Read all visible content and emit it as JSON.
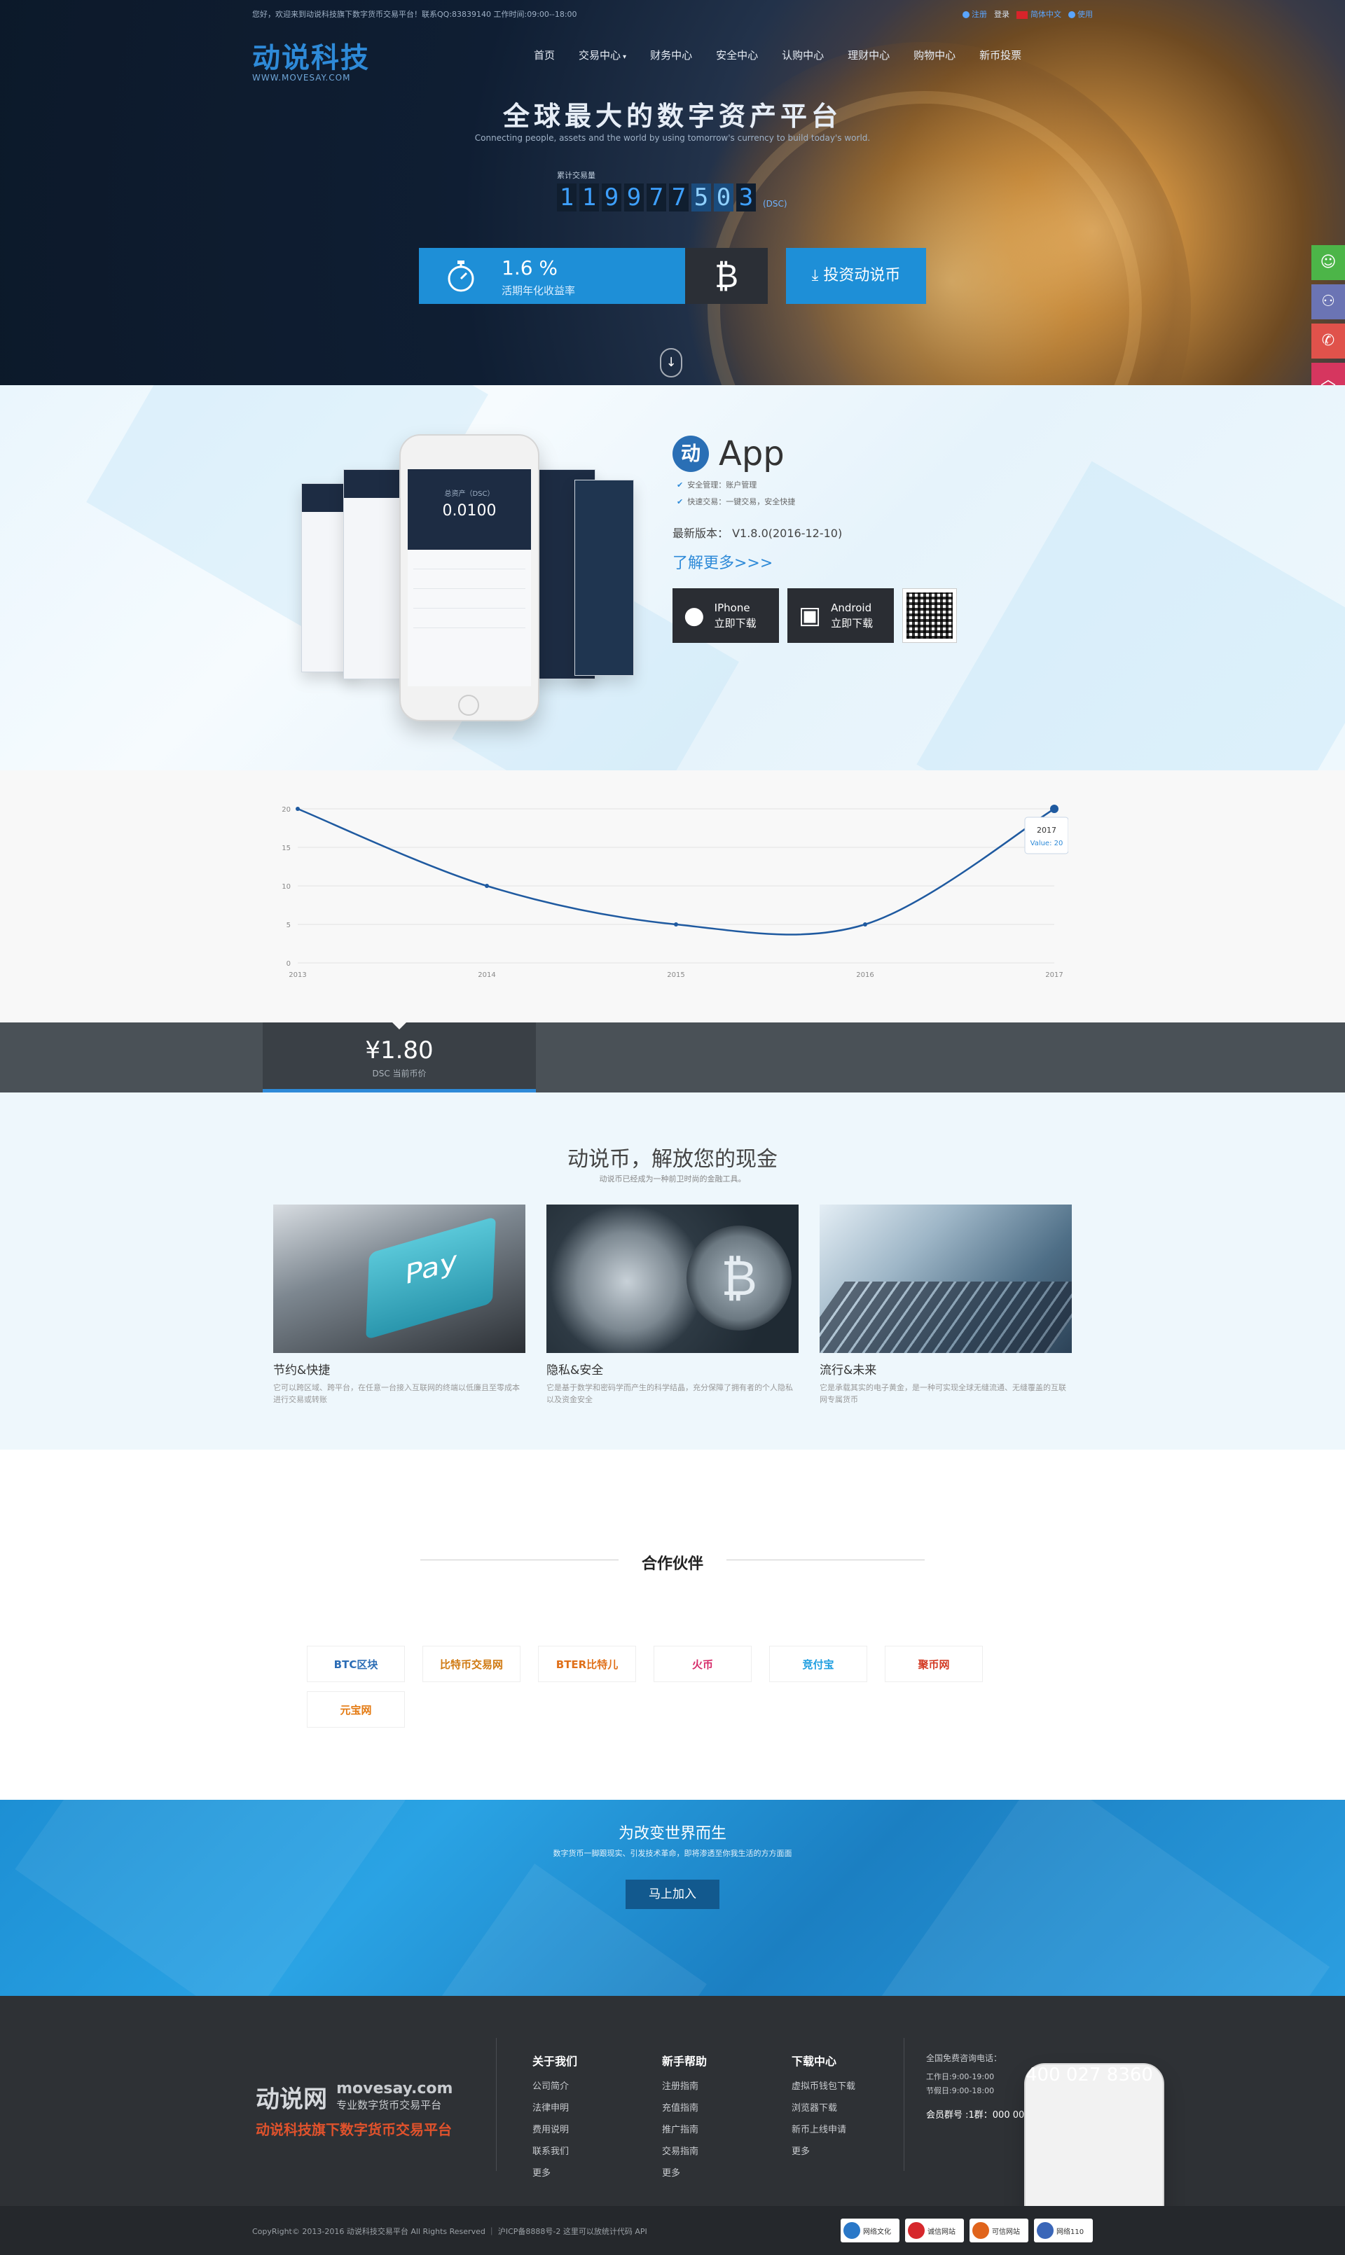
{
  "topbar": {
    "welcome": "您好，欢迎来到动说科技旗下数字货币交易平台！联系QQ:83839140 工作时间:09:00--18:00",
    "register": "注册",
    "login": "登录",
    "language": "简体中文",
    "lang_alt": "使用"
  },
  "logo": {
    "name": "动说科技",
    "domain": "WWW.MOVESAY.COM"
  },
  "nav": [
    {
      "label": "首页"
    },
    {
      "label": "交易中心",
      "chevron": "chevron-down-icon"
    },
    {
      "label": "财务中心"
    },
    {
      "label": "安全中心"
    },
    {
      "label": "认购中心"
    },
    {
      "label": "理财中心"
    },
    {
      "label": "购物中心"
    },
    {
      "label": "新币投票"
    }
  ],
  "hero": {
    "title": "全球最大的数字资产平台",
    "subtitle": "Connecting people, assets and the world by using tomorrow's currency to build today's world.",
    "counter_label": "累计交易量",
    "counter_digits": [
      "1",
      "1",
      "9",
      "9",
      "7",
      "7",
      "5",
      "0",
      "3"
    ],
    "counter_unit": "(DSC)",
    "rate_value": "1.6 %",
    "rate_label": "活期年化收益率",
    "btc_symbol": "₿",
    "invest_button": "投资动说币"
  },
  "app": {
    "logo_char": "动",
    "title": "App",
    "features": [
      "安全管理：账户管理",
      "快速交易：一键交易，安全快捷"
    ],
    "version": "最新版本： V1.8.0(2016-12-10)",
    "more_link": "了解更多>>>",
    "iphone_line1": "IPhone",
    "iphone_line2": "立即下载",
    "android_line1": "Android",
    "android_line2": "立即下载",
    "phone_balance_label": "总资产（DSC）",
    "phone_balance": "0.0100"
  },
  "chart_data": {
    "type": "line",
    "x": [
      "2013",
      "2014",
      "2015",
      "2016",
      "2017"
    ],
    "values": [
      20,
      10,
      5,
      5,
      20
    ],
    "ylim": [
      0,
      20
    ],
    "yticks": [
      0,
      5,
      10,
      15,
      20
    ],
    "grid": true,
    "tooltip": {
      "title": "2017",
      "value": "Value: 20"
    },
    "color": "#1f5aa0"
  },
  "price": {
    "value": "¥1.80",
    "label": "DSC 当前币价"
  },
  "features": {
    "title": "动说币，解放您的现金",
    "subtitle": "动说币已经成为一种前卫时尚的金融工具。",
    "cards": [
      {
        "title": "节约&快捷",
        "desc": "它可以跨区域、跨平台，在任意一台接入互联网的终端以低廉且至零成本进行交易或转账",
        "img_text": "Pay"
      },
      {
        "title": "隐私&安全",
        "desc": "它是基于数学和密码学而产生的科学结晶，充分保障了拥有者的个人隐私以及资金安全",
        "img_text": "₿"
      },
      {
        "title": "流行&未来",
        "desc": "它是承载其实的电子黄金，是一种可实现全球无缝流通、无缝覆盖的互联网专属货币"
      }
    ]
  },
  "partners": {
    "title": "合作伙伴",
    "logos": [
      {
        "name": "BTC区块",
        "color": "#2b6cb5"
      },
      {
        "name": "比特币交易网",
        "color": "#d07a12"
      },
      {
        "name": "BTER比特儿",
        "color": "#e0701a"
      },
      {
        "name": "火币",
        "color": "#d62b6a"
      },
      {
        "name": "竞付宝",
        "color": "#1e9ee0"
      },
      {
        "name": "聚币网",
        "color": "#d33a24"
      },
      {
        "name": "元宝网",
        "color": "#e47a12"
      }
    ]
  },
  "cta": {
    "title": "为改变世界而生",
    "subtitle": "数字货币一脚跟现实、引发技术革命，即将渗透至你我生活的方方面面",
    "button": "马上加入"
  },
  "footer": {
    "brand": "动说网",
    "domain": "movesay.com",
    "tagline": "专业数字货币交易平台",
    "slogan": "动说科技旗下数字货币交易平台",
    "columns": [
      {
        "title": "关于我们",
        "items": [
          "公司简介",
          "法律申明",
          "费用说明",
          "联系我们",
          "更多"
        ]
      },
      {
        "title": "新手帮助",
        "items": [
          "注册指南",
          "充值指南",
          "推广指南",
          "交易指南",
          "更多"
        ]
      },
      {
        "title": "下载中心",
        "items": [
          "虚拟币钱包下载",
          "浏览器下载",
          "新币上线申请",
          "更多"
        ]
      }
    ],
    "contact_label": "全国免费咨询电话：",
    "phone": "400 027 8360",
    "hours_work": "工作日:9:00-19:00",
    "hours_holiday": "节假日:9:00-18:00",
    "group": "会员群号 :1群：000 000 0000",
    "copyright": "CopyRight© 2013-2016 动说科技交易平台 All Rights Reserved ｜ 沪ICP备8888号-2 这里可以放统计代码 API",
    "badges": [
      "网络文化",
      "诚信网站",
      "可信网站",
      "网络110"
    ]
  },
  "colors": {
    "accent": "#1e8fd7",
    "dark": "#2e3135"
  }
}
